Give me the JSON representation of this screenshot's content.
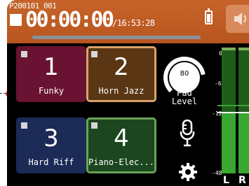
{
  "header": {
    "project_name": "P200101_001",
    "elapsed_time": "00:00:00",
    "remaining_time": "/16:53:28",
    "progress": 0.0,
    "battery_level": 0.85
  },
  "pads": [
    {
      "number": "1",
      "label": "Funky"
    },
    {
      "number": "2",
      "label": "Horn Jazz"
    },
    {
      "number": "3",
      "label": "Hard Riff"
    },
    {
      "number": "4",
      "label": "Piano-Elec..."
    }
  ],
  "pad_level": {
    "value": "80",
    "caption_line1": "Pad",
    "caption_line2": "Level",
    "fraction": 0.8
  },
  "meter": {
    "scale": [
      "0",
      "-6",
      "-12",
      "-48"
    ],
    "channels": [
      "L",
      "R"
    ]
  },
  "colors": {
    "header_bg": "#c0602a",
    "pad1": "#6a1232",
    "pad2": "#5a3614",
    "pad2_border": "#d8a46b",
    "pad3": "#1b2b56",
    "pad4": "#1c4620",
    "pad4_border": "#6aa256",
    "meter_green": "#2f9a28",
    "indicator_red": "#e02a2a"
  },
  "icons": {
    "status": "battery-icon",
    "speaker": "speaker-icon",
    "input": "microphone-icon",
    "settings": "gear-icon"
  }
}
